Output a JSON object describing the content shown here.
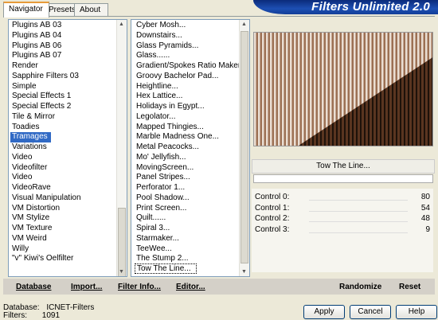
{
  "tabs": [
    {
      "label": "Navigator"
    },
    {
      "label": "Presets"
    },
    {
      "label": "About"
    }
  ],
  "title": "Filters Unlimited 2.0",
  "categories": [
    "Plugins AB 03",
    "Plugins AB 04",
    "Plugins AB 06",
    "Plugins AB 07",
    "Render",
    "Sapphire Filters 03",
    "Simple",
    "Special Effects 1",
    "Special Effects 2",
    "Tile & Mirror",
    "Toadies",
    "Tramages",
    "Variations",
    "Video",
    "Videofilter",
    "Video",
    "VideoRave",
    "Visual Manipulation",
    "VM Distortion",
    "VM Stylize",
    "VM Texture",
    "VM Weird",
    "Willy",
    "\"v\" Kiwi's Oelfilter"
  ],
  "selected_category": "Tramages",
  "filters": [
    "Cyber Mosh...",
    "Downstairs...",
    "Glass Pyramids...",
    "Glass......",
    "Gradient/Spokes Ratio Maker...",
    "Groovy Bachelor Pad...",
    "Heightline...",
    "Hex Lattice...",
    "Holidays in Egypt...",
    "Legolator...",
    "Mapped Thingies...",
    "Marble Madness One...",
    "Metal Peacocks...",
    "Mo' Jellyfish...",
    "MovingScreen...",
    "Panel Stripes...",
    "Perforator 1...",
    "Pool Shadow...",
    "Print Screen...",
    "Quilt......",
    "Spiral 3...",
    "Starmaker...",
    "TeeWee...",
    "The Stump 2...",
    "Tow The Line..."
  ],
  "selected_filter": "Tow The Line...",
  "filter_name": "Tow The Line...",
  "controls": [
    {
      "label": "Control 0:",
      "value": "80"
    },
    {
      "label": "Control 1:",
      "value": "54"
    },
    {
      "label": "Control 2:",
      "value": "48"
    },
    {
      "label": "Control 3:",
      "value": "9"
    }
  ],
  "toolbar": {
    "database": "Database",
    "import": "Import...",
    "filter_info": "Filter Info...",
    "editor": "Editor...",
    "randomize": "Randomize",
    "reset": "Reset"
  },
  "status": {
    "database_label": "Database:",
    "database_value": "ICNET-Filters",
    "filters_label": "Filters:",
    "filters_value": "1091"
  },
  "buttons": {
    "apply": "Apply",
    "cancel": "Cancel",
    "help": "Help"
  }
}
